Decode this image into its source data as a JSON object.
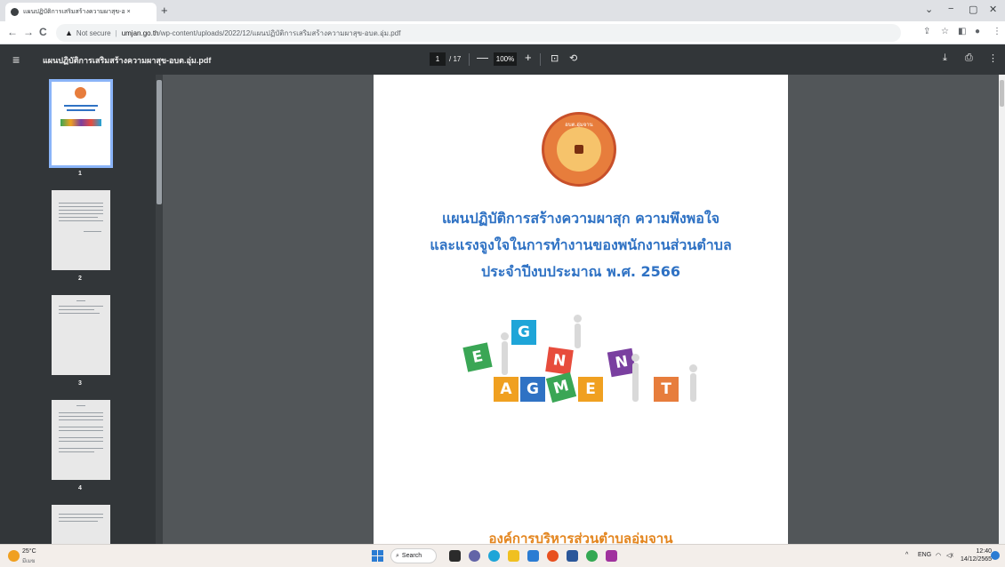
{
  "browser": {
    "tab_title": "แผนปฏิบัติการเสริมสร้างความผาสุข-อ ×",
    "tab_close": "×",
    "new_tab": "+",
    "win_min": "−",
    "win_max": "▢",
    "win_close": "✕",
    "win_chevron": "⌄",
    "back": "←",
    "forward": "→",
    "reload": "C",
    "security_icon": "▲",
    "security_label": "Not secure",
    "url_host": "umjan.go.th",
    "url_path": "/wp-content/uploads/2022/12/แผนปฏิบัติการเสริมสร้างความผาสุข-อบต.อุ่ม.pdf"
  },
  "pdf_toolbar": {
    "title": "แผนปฏิบัติการเสริมสร้างความผาสุข-อบต.อุ่ม.pdf",
    "page_current": "1",
    "page_total": "/ 17",
    "zoom_out": "—",
    "zoom_level": "100%",
    "zoom_in": "+",
    "fit_icon": "⊡",
    "rotate_icon": "⟲",
    "download_icon": "⤓",
    "print_icon": "⎙",
    "more_icon": "⋮"
  },
  "thumbnails": [
    {
      "label": "1"
    },
    {
      "label": "2"
    },
    {
      "label": "3"
    },
    {
      "label": "4"
    }
  ],
  "document": {
    "seal_top": "อบต.อุ่มจาน",
    "seal_bottom": "อำเภอกุสุมาลย์ จังหวัดสกลนคร",
    "title_line1": "แผนปฏิบัติการสร้างความผาสุก ความพึงพอใจ",
    "title_line2": "และแรงจูงใจในการทำงานของพนักงานส่วนตำบล",
    "title_line3": "ประจำปีงบประมาณ พ.ศ. 2566",
    "blocks": [
      "E",
      "G",
      "N",
      "A",
      "G",
      "M",
      "E",
      "N",
      "T"
    ],
    "footer_org": "องค์การบริหารส่วนตำบลอุ่มจาน"
  },
  "taskbar": {
    "temperature": "25°C",
    "weather_desc": "มีเมฆ",
    "search_label": "Search",
    "search_icon": "⌕",
    "tray_chevron": "^",
    "lang": "ENG",
    "wifi_icon": "◠",
    "volume_icon": "◁ᵡ",
    "time": "12:40",
    "date": "14/12/2565"
  },
  "colors": {
    "title_blue": "#2f72c4",
    "footer_orange": "#e3851e",
    "viewer_bg": "#525659",
    "toolbar_bg": "#323639"
  }
}
